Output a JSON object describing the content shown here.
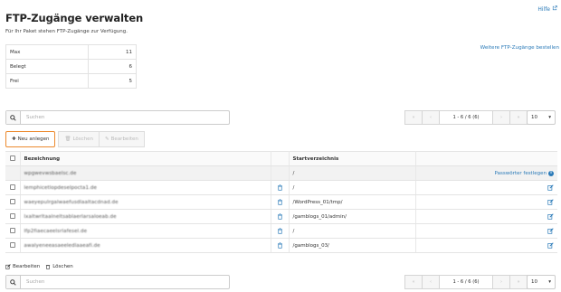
{
  "help": {
    "label": "Hilfe"
  },
  "page": {
    "title": "FTP-Zugänge verwalten",
    "subtitle": "Für Ihr Paket stehen FTP-Zugänge zur Verfügung."
  },
  "quota": [
    {
      "label": "Max",
      "value": "11"
    },
    {
      "label": "Belegt",
      "value": "6"
    },
    {
      "label": "Frei",
      "value": "5"
    }
  ],
  "more_link": "Weitere FTP-Zugänge bestellen",
  "search": {
    "placeholder": "Suchen"
  },
  "pager": {
    "info": "1 - 6 / 6 (6)",
    "per_page": "10",
    "first": "«",
    "prev": "‹",
    "next": "›",
    "last": "»"
  },
  "toolbar": {
    "new_label": "Neu anlegen",
    "delete_label": "Löschen",
    "edit_label": "Bearbeiten"
  },
  "table": {
    "headers": {
      "name": "Bezeichnung",
      "dir": "Startverzeichnis"
    },
    "rows": [
      {
        "name": "wpgwevwsbaelsc.de",
        "dir": "/",
        "action": "Passwörter festlegen",
        "first": true
      },
      {
        "name": "lemphicetlopdeselpocta1.de",
        "dir": "/"
      },
      {
        "name": "waeyepulrgalwaefusdlaaltacdnad.de",
        "dir": "/WordPress_01/tmp/"
      },
      {
        "name": "lxaltwrltaalneltsablaerlarsaloeab.de",
        "dir": "/gamblogs_01/admin/"
      },
      {
        "name": "lfp2fiaecaeelsrlafesel.de",
        "dir": "/"
      },
      {
        "name": "awalyeneeasaeeledlaaeafi.de",
        "dir": "/gamblogs_03/"
      }
    ]
  },
  "bottom": {
    "edit_label": "Bearbeiten",
    "delete_label": "Löschen"
  },
  "colors": {
    "accent": "#2a7ab8",
    "highlight": "#ec8a2e"
  }
}
